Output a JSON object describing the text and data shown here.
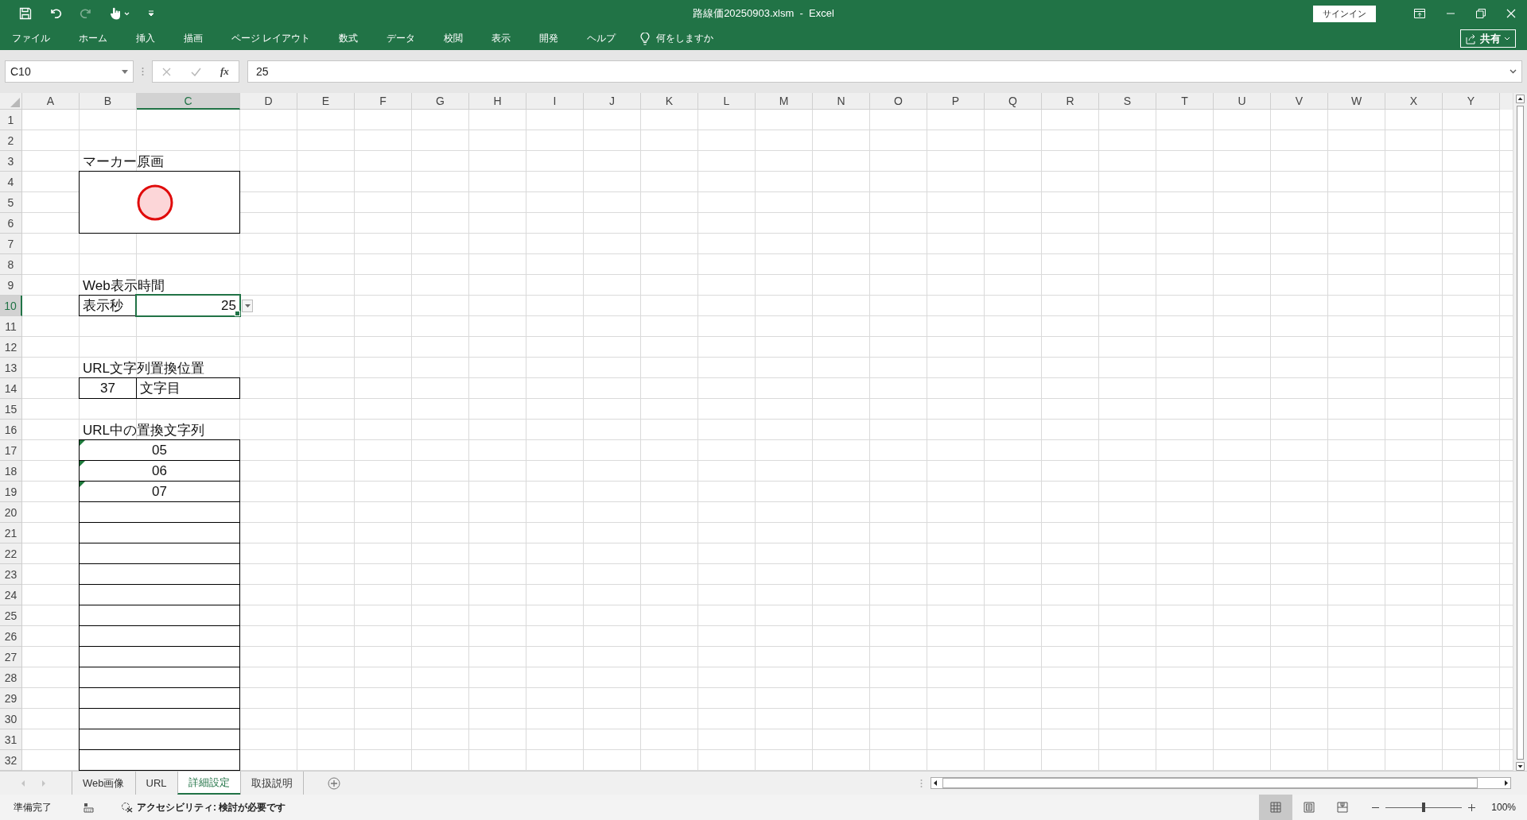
{
  "title_bar": {
    "title": "路線価20250903.xlsm  -  Excel",
    "redo_disabled": true,
    "sign_in": "サインイン"
  },
  "ribbon_tabs": [
    {
      "label": "ファイル"
    },
    {
      "label": "ホーム"
    },
    {
      "label": "挿入"
    },
    {
      "label": "描画"
    },
    {
      "label": "ページ レイアウト"
    },
    {
      "label": "数式"
    },
    {
      "label": "データ"
    },
    {
      "label": "校閲"
    },
    {
      "label": "表示"
    },
    {
      "label": "開発"
    },
    {
      "label": "ヘルプ"
    }
  ],
  "tell_me": "何をしますか",
  "share": "共有",
  "formula_bar": {
    "name_box": "C10",
    "fx": "fx",
    "value": "25"
  },
  "sheet": {
    "columns": [
      {
        "label": "A",
        "selected": false
      },
      {
        "label": "B",
        "selected": false
      },
      {
        "label": "C",
        "selected": true
      },
      {
        "label": "D",
        "selected": false
      },
      {
        "label": "E",
        "selected": false
      },
      {
        "label": "F",
        "selected": false
      },
      {
        "label": "G",
        "selected": false
      },
      {
        "label": "H",
        "selected": false
      },
      {
        "label": "I",
        "selected": false
      },
      {
        "label": "J",
        "selected": false
      },
      {
        "label": "K",
        "selected": false
      },
      {
        "label": "L",
        "selected": false
      },
      {
        "label": "M",
        "selected": false
      },
      {
        "label": "N",
        "selected": false
      },
      {
        "label": "O",
        "selected": false
      },
      {
        "label": "P",
        "selected": false
      },
      {
        "label": "Q",
        "selected": false
      },
      {
        "label": "R",
        "selected": false
      },
      {
        "label": "S",
        "selected": false
      },
      {
        "label": "T",
        "selected": false
      },
      {
        "label": "U",
        "selected": false
      },
      {
        "label": "V",
        "selected": false
      },
      {
        "label": "W",
        "selected": false
      },
      {
        "label": "X",
        "selected": false
      },
      {
        "label": "Y",
        "selected": false
      }
    ],
    "rows": [
      {
        "label": "1",
        "selected": false
      },
      {
        "label": "2",
        "selected": false
      },
      {
        "label": "3",
        "selected": false
      },
      {
        "label": "4",
        "selected": false
      },
      {
        "label": "5",
        "selected": false
      },
      {
        "label": "6",
        "selected": false
      },
      {
        "label": "7",
        "selected": false
      },
      {
        "label": "8",
        "selected": false
      },
      {
        "label": "9",
        "selected": false
      },
      {
        "label": "10",
        "selected": true
      },
      {
        "label": "11",
        "selected": false
      },
      {
        "label": "12",
        "selected": false
      },
      {
        "label": "13",
        "selected": false
      },
      {
        "label": "14",
        "selected": false
      },
      {
        "label": "15",
        "selected": false
      },
      {
        "label": "16",
        "selected": false
      },
      {
        "label": "17",
        "selected": false
      },
      {
        "label": "18",
        "selected": false
      },
      {
        "label": "19",
        "selected": false
      },
      {
        "label": "20",
        "selected": false
      },
      {
        "label": "21",
        "selected": false
      },
      {
        "label": "22",
        "selected": false
      },
      {
        "label": "23",
        "selected": false
      },
      {
        "label": "24",
        "selected": false
      },
      {
        "label": "25",
        "selected": false
      },
      {
        "label": "26",
        "selected": false
      },
      {
        "label": "27",
        "selected": false
      },
      {
        "label": "28",
        "selected": false
      },
      {
        "label": "29",
        "selected": false
      },
      {
        "label": "30",
        "selected": false
      },
      {
        "label": "31",
        "selected": false
      },
      {
        "label": "32",
        "selected": false
      }
    ],
    "cells": {
      "B3": {
        "kind": "heading",
        "text": "マーカー原画",
        "flagged": false,
        "selected": false,
        "dropdown": false
      },
      "B4": {
        "kind": "marker",
        "flagged": false,
        "selected": false,
        "dropdown": false
      },
      "B9": {
        "kind": "heading",
        "text": "Web表示時間",
        "flagged": false,
        "selected": false,
        "dropdown": false
      },
      "B10": {
        "kind": "text_cell",
        "text": "表示秒",
        "flagged": false,
        "selected": false,
        "dropdown": false
      },
      "C10": {
        "kind": "number_cell",
        "text": "25",
        "flagged": false,
        "selected": true,
        "dropdown": true
      },
      "B13": {
        "kind": "heading",
        "text": "URL文字列置換位置",
        "flagged": false,
        "selected": false,
        "dropdown": false
      },
      "B14": {
        "kind": "centered_cell",
        "text": "37",
        "flagged": false,
        "selected": false,
        "dropdown": false
      },
      "C14": {
        "kind": "text_cell",
        "text": "文字目",
        "flagged": false,
        "selected": false,
        "dropdown": false
      },
      "B16": {
        "kind": "heading",
        "text": "URL中の置換文字列",
        "flagged": false,
        "selected": false,
        "dropdown": false
      },
      "B17": {
        "kind": "merged_cell",
        "text": "05",
        "flagged": true,
        "selected": false,
        "dropdown": false
      },
      "B18": {
        "kind": "merged_cell",
        "text": "06",
        "flagged": true,
        "selected": false,
        "dropdown": false
      },
      "B19": {
        "kind": "merged_cell",
        "text": "07",
        "flagged": true,
        "selected": false,
        "dropdown": false
      },
      "B20": {
        "kind": "merged_cell",
        "flagged": false,
        "selected": false,
        "dropdown": false
      },
      "B21": {
        "kind": "merged_cell",
        "flagged": false,
        "selected": false,
        "dropdown": false
      },
      "B22": {
        "kind": "merged_cell",
        "flagged": false,
        "selected": false,
        "dropdown": false
      },
      "B23": {
        "kind": "merged_cell",
        "flagged": false,
        "selected": false,
        "dropdown": false
      },
      "B24": {
        "kind": "merged_cell",
        "flagged": false,
        "selected": false,
        "dropdown": false
      },
      "B25": {
        "kind": "merged_cell",
        "flagged": false,
        "selected": false,
        "dropdown": false
      },
      "B26": {
        "kind": "merged_cell",
        "flagged": false,
        "selected": false,
        "dropdown": false
      },
      "B27": {
        "kind": "merged_cell",
        "flagged": false,
        "selected": false,
        "dropdown": false
      },
      "B28": {
        "kind": "merged_cell",
        "flagged": false,
        "selected": false,
        "dropdown": false
      },
      "B29": {
        "kind": "merged_cell",
        "flagged": false,
        "selected": false,
        "dropdown": false
      },
      "B30": {
        "kind": "merged_cell",
        "flagged": false,
        "selected": false,
        "dropdown": false
      },
      "B31": {
        "kind": "merged_cell",
        "flagged": false,
        "selected": false,
        "dropdown": false
      },
      "B32": {
        "kind": "merged_cell",
        "flagged": false,
        "selected": false,
        "dropdown": false
      }
    }
  },
  "sheet_tabs": [
    {
      "label": "Web画像",
      "selected": false
    },
    {
      "label": "URL",
      "selected": false
    },
    {
      "label": "詳細設定",
      "selected": true
    },
    {
      "label": "取扱説明",
      "selected": false
    }
  ],
  "status_bar": {
    "ready": "準備完了",
    "accessibility": "アクセシビリティ: 検討が必要です",
    "views": [
      {
        "kind": "normal",
        "selected": true
      },
      {
        "kind": "page_layout",
        "selected": false
      },
      {
        "kind": "page_break",
        "selected": false
      }
    ],
    "zoom": {
      "level": 0.5,
      "reading": "100%"
    }
  }
}
